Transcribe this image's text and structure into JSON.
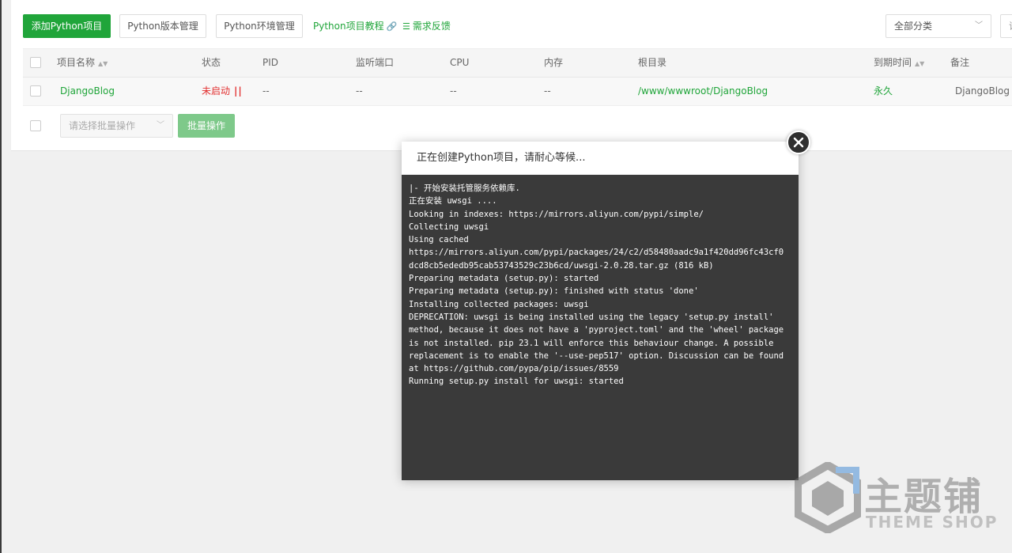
{
  "toolbar": {
    "add_button": "添加Python项目",
    "version_button": "Python版本管理",
    "env_button": "Python环境管理",
    "tutorial_link": "Python项目教程",
    "feedback_link": "需求反馈",
    "category_select": "全部分类",
    "search_placeholder": "请输"
  },
  "table": {
    "headers": [
      "项目名称",
      "状态",
      "PID",
      "监听端口",
      "CPU",
      "内存",
      "根目录",
      "到期时间",
      "备注"
    ],
    "rows": [
      {
        "name": "DjangoBlog",
        "status": "未启动",
        "pid": "--",
        "port": "--",
        "cpu": "--",
        "memory": "--",
        "root": "/www/wwwroot/DjangoBlog",
        "expire": "永久",
        "note": "DjangoBlog"
      }
    ]
  },
  "batch": {
    "select_placeholder": "请选择批量操作",
    "button": "批量操作"
  },
  "modal": {
    "title": "正在创建Python项目，请耐心等候...",
    "log": [
      "|- 开始安装托管服务依赖库.",
      "正在安装 uwsgi ....",
      "Looking in indexes: https://mirrors.aliyun.com/pypi/simple/",
      "Collecting uwsgi",
      "Using cached",
      "https://mirrors.aliyun.com/pypi/packages/24/c2/d58480aadc9a1f420dd96fc43cf0",
      "dcd8cb5ededb95cab53743529c23b6cd/uwsgi-2.0.28.tar.gz (816 kB)",
      "Preparing metadata (setup.py): started",
      "Preparing metadata (setup.py): finished with status 'done'",
      "Installing collected packages: uwsgi",
      "DEPRECATION: uwsgi is being installed using the legacy 'setup.py install'",
      "method, because it does not have a 'pyproject.toml' and the 'wheel' package",
      "is not installed. pip 23.1 will enforce this behaviour change. A possible",
      "replacement is to enable the '--use-pep517' option. Discussion can be found",
      "at https://github.com/pypa/pip/issues/8559",
      "Running setup.py install for uwsgi: started"
    ]
  },
  "watermark": {
    "cn": "主题铺",
    "en": "THEME SHOP"
  },
  "colors": {
    "accent": "#20a53a",
    "danger": "#e23030",
    "terminal_bg": "#3a3a3a"
  }
}
